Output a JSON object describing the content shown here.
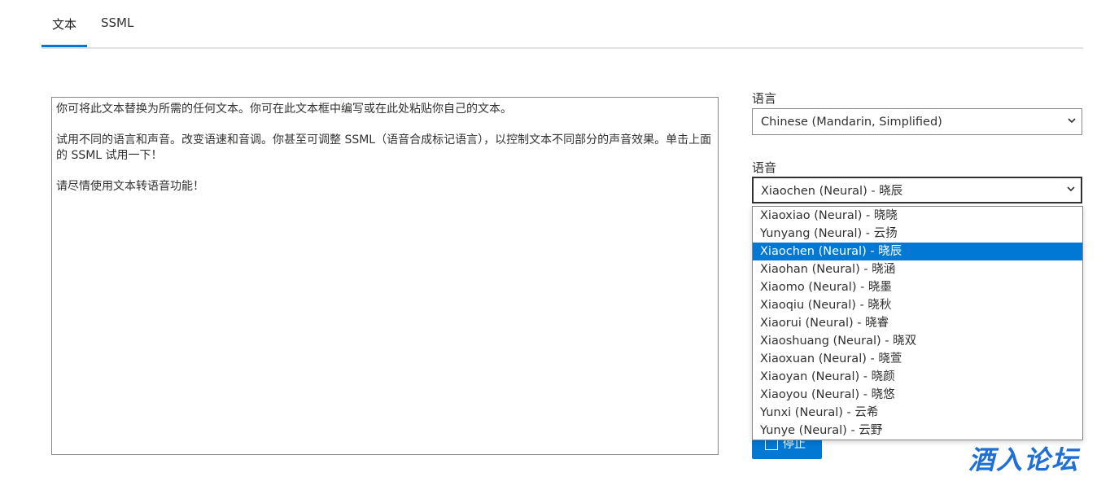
{
  "tabs": [
    {
      "label": "文本",
      "active": true
    },
    {
      "label": "SSML",
      "active": false
    }
  ],
  "editor": {
    "text": "你可将此文本替换为所需的任何文本。你可在此文本框中编写或在此处粘贴你自己的文本。\n\n试用不同的语言和声音。改变语速和音调。你甚至可调整 SSML（语音合成标记语言），以控制文本不同部分的声音效果。单击上面的 SSML 试用一下！\n\n请尽情使用文本转语音功能！"
  },
  "language": {
    "label": "语言",
    "selected": "Chinese (Mandarin, Simplified)"
  },
  "voice": {
    "label": "语音",
    "selected": "Xiaochen (Neural) - 晓辰",
    "options": [
      "Xiaoxiao (Neural) - 晓晓",
      "Yunyang (Neural) - 云扬",
      "Xiaochen (Neural) - 晓辰",
      "Xiaohan (Neural) - 晓涵",
      "Xiaomo (Neural) - 晓墨",
      "Xiaoqiu (Neural) - 晓秋",
      "Xiaorui (Neural) - 晓睿",
      "Xiaoshuang (Neural) - 晓双",
      "Xiaoxuan (Neural) - 晓萱",
      "Xiaoyan (Neural) - 晓颜",
      "Xiaoyou (Neural) - 晓悠",
      "Yunxi (Neural) - 云希",
      "Yunye (Neural) - 云野"
    ],
    "selected_index": 2
  },
  "stop_button": {
    "label": "停止"
  },
  "watermark": {
    "text": "酒入论坛"
  },
  "colors": {
    "accent": "#0078d4",
    "text": "#323130",
    "border": "#8a8886"
  }
}
